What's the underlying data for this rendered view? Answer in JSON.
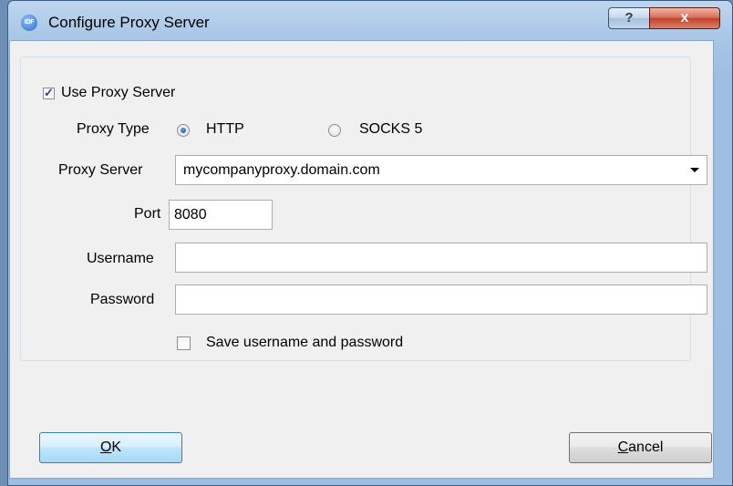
{
  "window": {
    "title": "Configure Proxy Server",
    "app_icon_text": "IDF",
    "help_glyph": "?",
    "close_glyph": "x"
  },
  "proxy": {
    "use_proxy_label": "Use Proxy Server",
    "use_proxy_checked": true,
    "type_label": "Proxy Type",
    "type_options": [
      "HTTP",
      "SOCKS 5"
    ],
    "type_selected": "HTTP",
    "server_label": "Proxy Server",
    "server_value": "mycompanyproxy.domain.com",
    "port_label": "Port",
    "port_value": "8080",
    "username_label": "Username",
    "username_value": "",
    "password_label": "Password",
    "password_value": "",
    "save_label": "Save username and password",
    "save_checked": false
  },
  "buttons": {
    "ok_mnemonic": "O",
    "ok_rest": "K",
    "cancel_mnemonic": "C",
    "cancel_rest": "ancel"
  }
}
